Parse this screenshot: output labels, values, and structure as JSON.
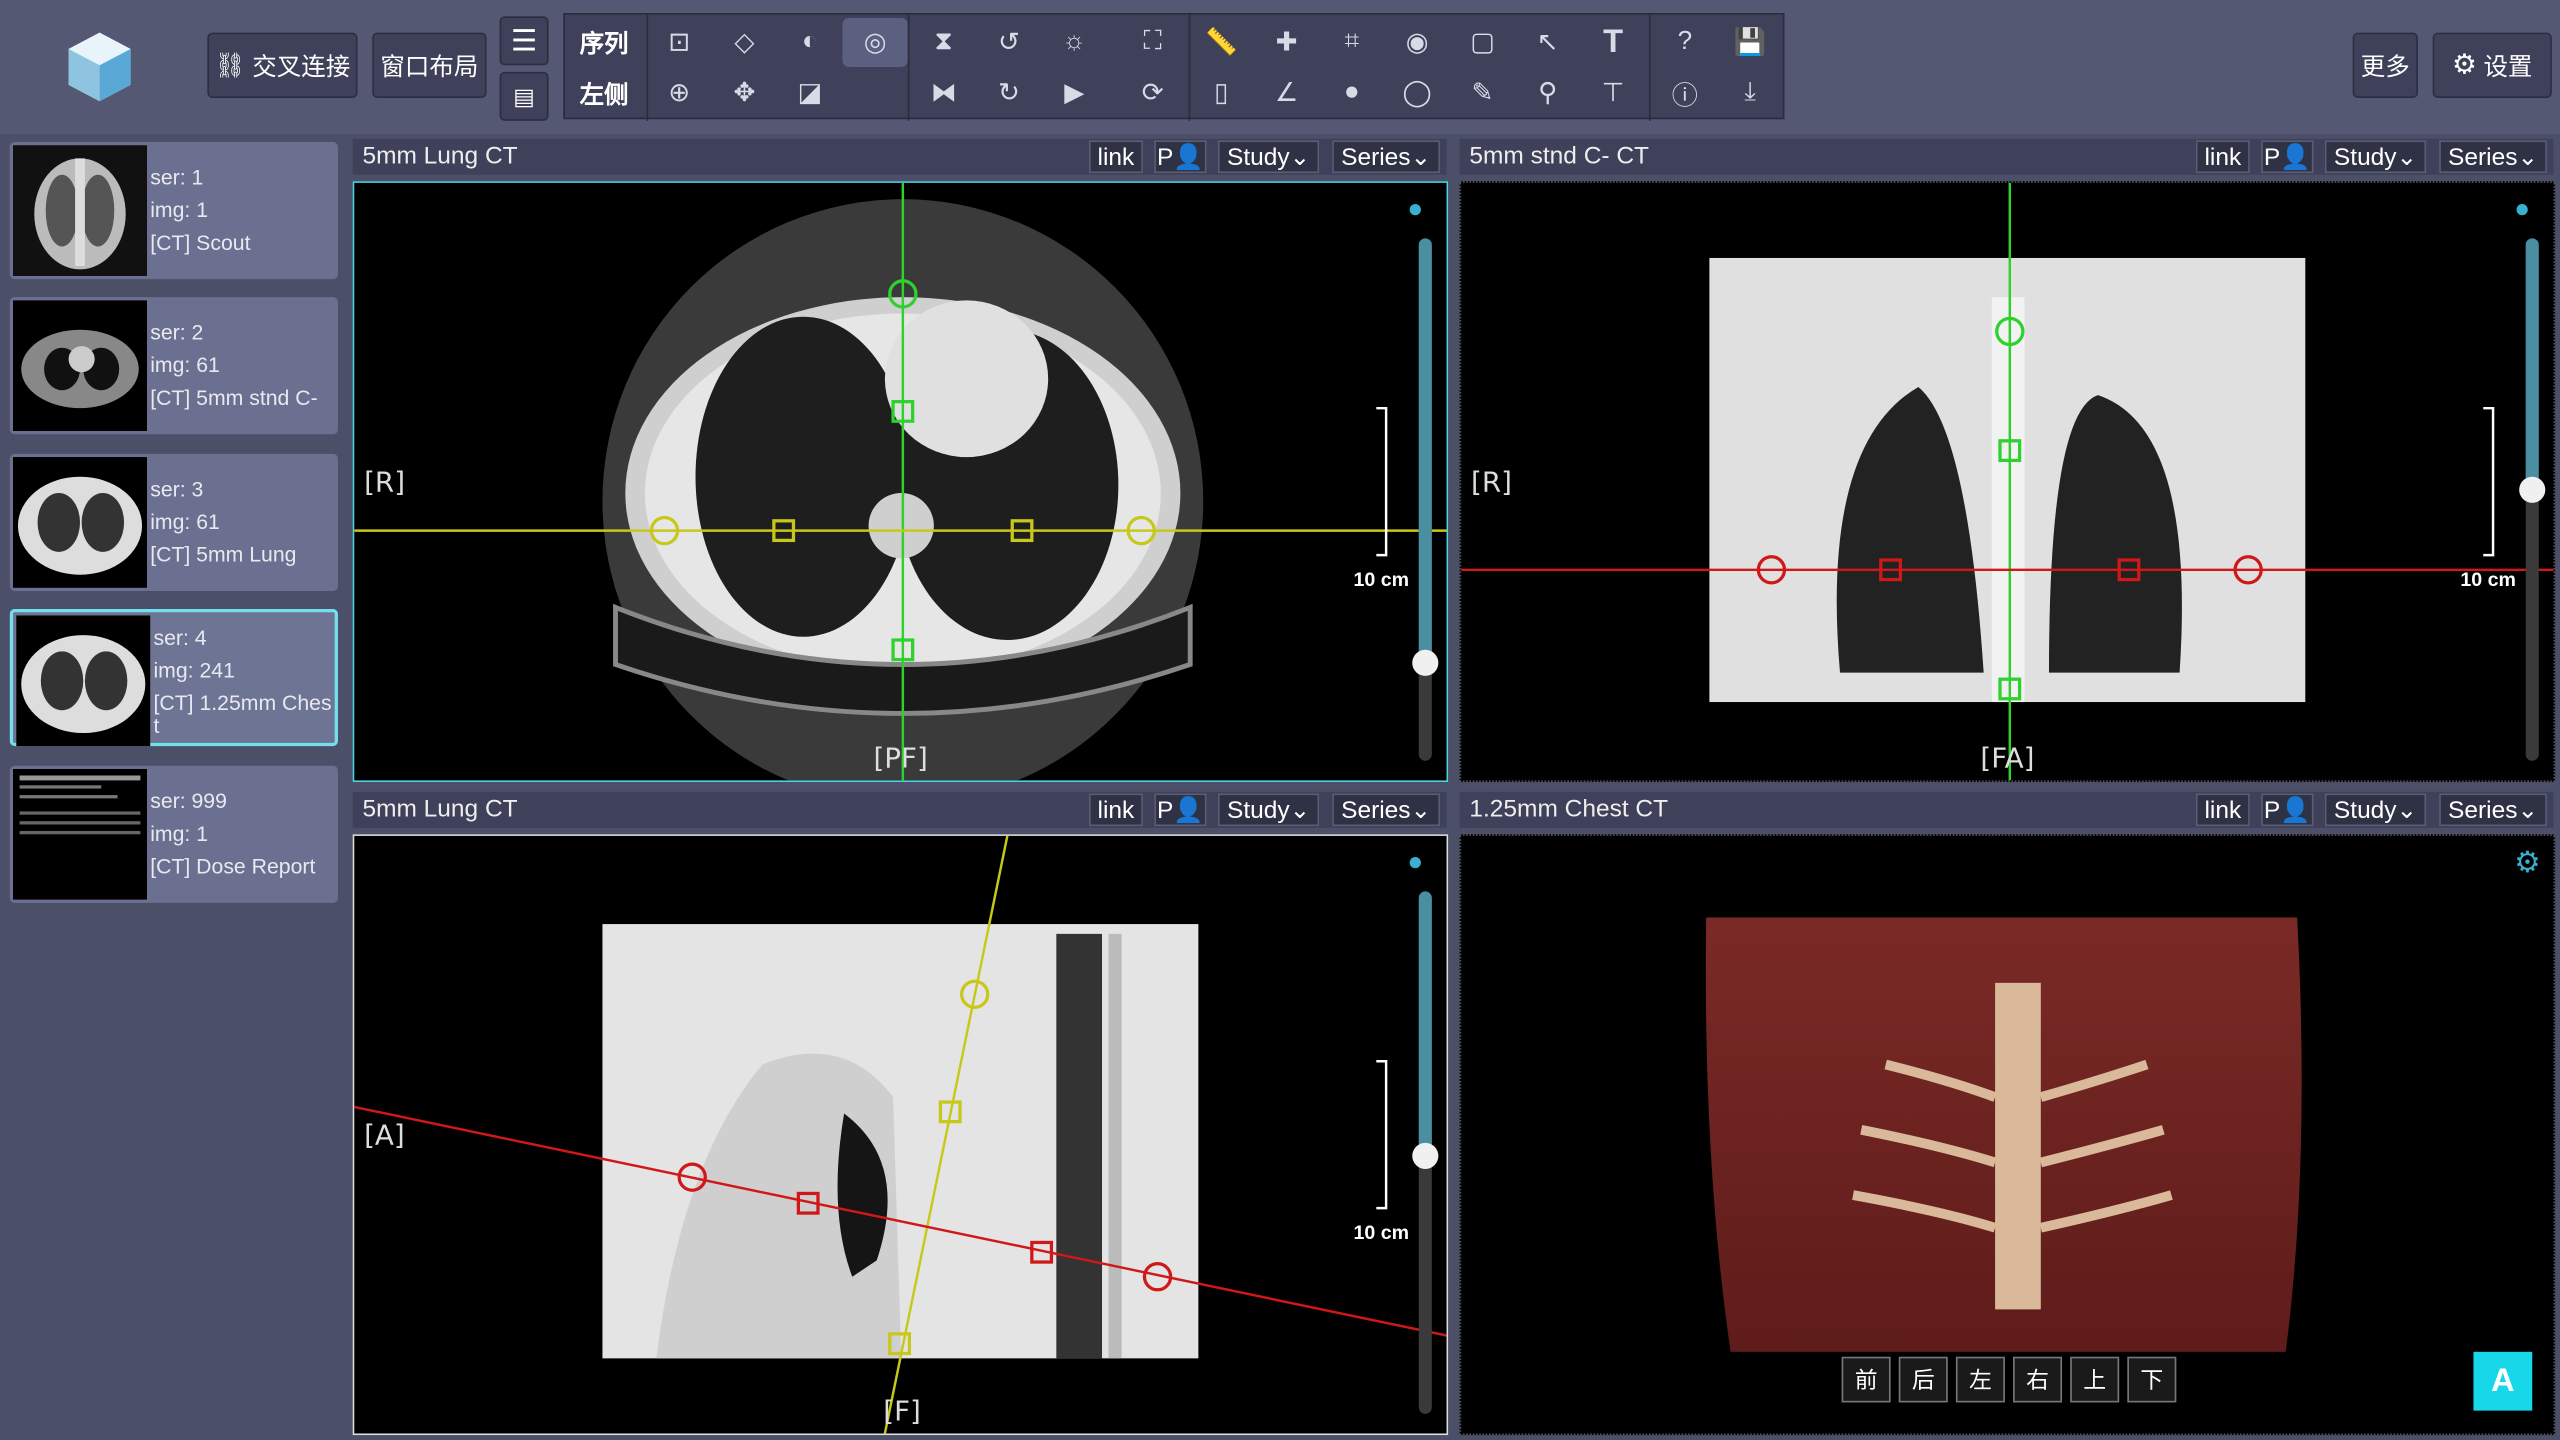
{
  "toolbar": {
    "link_label": "交叉连接",
    "layout_label": "窗口布局",
    "row1_label": "序列",
    "row2_label": "左侧",
    "more_label": "更多",
    "settings_label": "设置"
  },
  "series": [
    {
      "ser": "ser: 1",
      "img": "img: 1",
      "desc": "[CT] Scout"
    },
    {
      "ser": "ser: 2",
      "img": "img: 61",
      "desc": "[CT] 5mm stnd C-"
    },
    {
      "ser": "ser: 3",
      "img": "img: 61",
      "desc": "[CT] 5mm Lung"
    },
    {
      "ser": "ser: 4",
      "img": "img: 241",
      "desc": "[CT] 1.25mm Ches",
      "desc2": "t"
    },
    {
      "ser": "ser: 999",
      "img": "img: 1",
      "desc": "[CT] Dose Report"
    }
  ],
  "viewports": [
    {
      "title": "5mm Lung  CT",
      "left": "[R]",
      "bottom": "[PF]",
      "scale": "10 cm"
    },
    {
      "title": "5mm stnd C-  CT",
      "left": "[R]",
      "bottom": "[FA]",
      "scale": "10 cm"
    },
    {
      "title": "5mm Lung  CT",
      "left": "[A]",
      "bottom": "[F]",
      "scale": "10 cm"
    },
    {
      "title": "1.25mm Chest  CT"
    }
  ],
  "header_buttons": {
    "link": "link",
    "patient": "P",
    "study": "Study",
    "series": "Series"
  },
  "nav_buttons": [
    "前",
    "后",
    "左",
    "右",
    "上",
    "下"
  ],
  "a_button": "A"
}
